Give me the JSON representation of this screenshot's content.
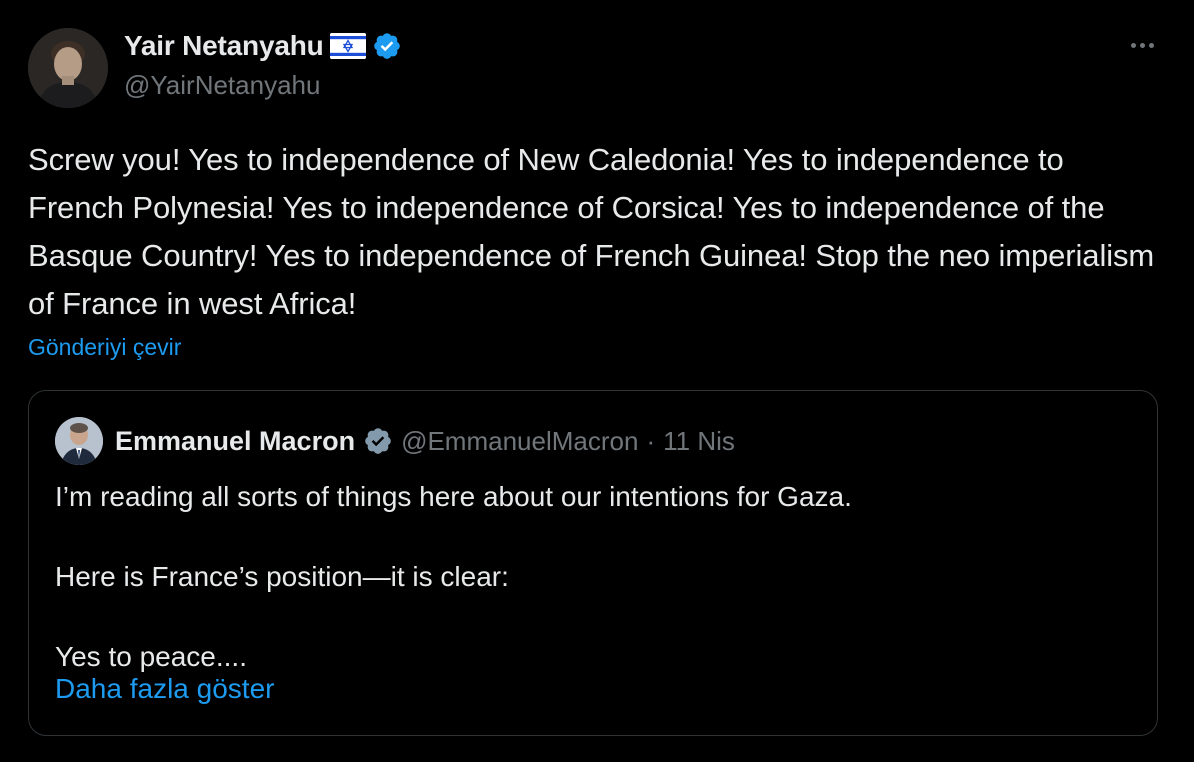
{
  "author": {
    "name": "Yair Netanyahu",
    "handle": "@YairNetanyahu",
    "flag": "israel-flag-icon",
    "verified_color": "#1d9bf0"
  },
  "tweet": {
    "text": "Screw you! Yes to independence of New Caledonia! Yes to independence to French Polynesia! Yes to independence of Corsica! Yes to independence of the Basque Country! Yes to independence of French Guinea! Stop the neo imperialism of France in west Africa!",
    "translate_label": "Gönderiyi çevir"
  },
  "quote": {
    "name": "Emmanuel Macron",
    "handle": "@EmmanuelMacron",
    "separator": "·",
    "date": "11 Nis",
    "verified_color": "#829aab",
    "lines": [
      "I’m reading all sorts of things here about our intentions for Gaza.",
      "",
      "Here is France’s position—it is clear:",
      "",
      "Yes to peace...."
    ],
    "show_more_label": "Daha fazla göster"
  },
  "colors": {
    "background": "#000000",
    "text": "#e7e9ea",
    "secondary": "#71767b",
    "link": "#1d9bf0",
    "border": "#2f3336"
  }
}
